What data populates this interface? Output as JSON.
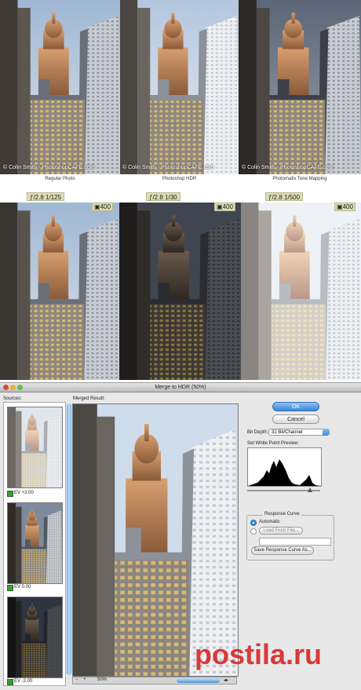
{
  "row1": {
    "watermark": "© Colin Smith - PhotoshopCAFE.com",
    "captions": [
      "Regular Photo",
      "Photoshop HDR",
      "Photomatix Tone Mapping"
    ]
  },
  "row2": {
    "panels": [
      {
        "exposure": "ƒ/2.8  1/125",
        "iso": "400"
      },
      {
        "exposure": "ƒ/2.8  1/30",
        "iso": "400"
      },
      {
        "exposure": "ƒ/2.8  1/500",
        "iso": "400"
      }
    ]
  },
  "dialog": {
    "title": "Merge to HDR (50%)",
    "sources_label": "Sources:",
    "merged_label": "Merged Result:",
    "sources": [
      {
        "ev": "EV +2.00",
        "checked": true
      },
      {
        "ev": "EV 0.00",
        "checked": true
      },
      {
        "ev": "EV -2.00",
        "checked": true
      }
    ],
    "ok_label": "OK",
    "cancel_label": "Cancel",
    "bit_depth_label": "Bit Depth:",
    "bit_depth_value": "32 Bit/Channel",
    "white_point_label": "Set White Point Preview:",
    "response_curve_label": "Response Curve",
    "automatic_label": "Automatic",
    "load_from_file_label": "Load From File...",
    "save_curve_label": "Save Response Curve As...",
    "zoom": "50%"
  },
  "footer": {
    "logo": "postila.ru"
  }
}
